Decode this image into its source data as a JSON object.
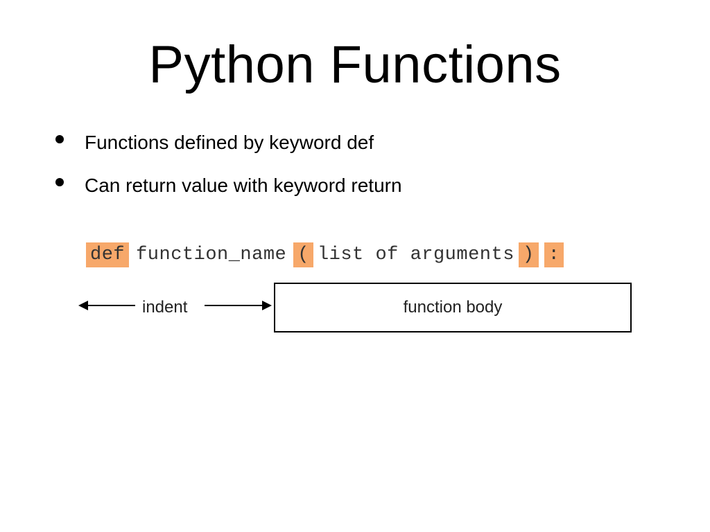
{
  "title": "Python Functions",
  "bullets": [
    "Functions defined by keyword def",
    "Can return value with keyword return"
  ],
  "diagram": {
    "def_keyword": "def",
    "function_name": "function_name",
    "open_paren": "(",
    "args_text": "list of arguments",
    "close_paren": ")",
    "colon": ":",
    "indent_label": "indent",
    "body_label": "function body"
  }
}
